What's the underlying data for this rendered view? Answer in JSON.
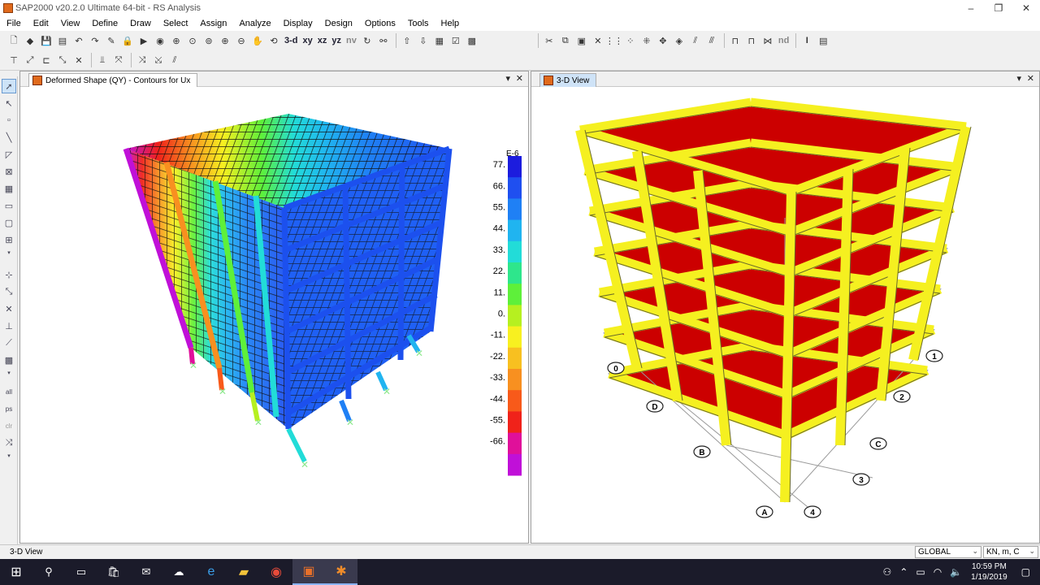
{
  "window": {
    "title": "SAP2000 v20.2.0 Ultimate 64-bit - RS Analysis",
    "controls": [
      "–",
      "❐",
      "✕"
    ]
  },
  "menu": [
    "File",
    "Edit",
    "View",
    "Define",
    "Draw",
    "Select",
    "Assign",
    "Analyze",
    "Display",
    "Design",
    "Options",
    "Tools",
    "Help"
  ],
  "toolbar": {
    "view_3d": "3-d",
    "view_xy": "xy",
    "view_xz": "xz",
    "view_yz": "yz",
    "view_nv": "nv",
    "nd": "nd"
  },
  "left_panel": {
    "tab_title": "Deformed Shape (QY) - Contours for Ux",
    "legend": {
      "exponent": "E-6",
      "labels": [
        "77.",
        "66.",
        "55.",
        "44.",
        "33.",
        "22.",
        "11.",
        "0.",
        "-11.",
        "-22.",
        "-33.",
        "-44.",
        "-55.",
        "-66."
      ],
      "colors": [
        "#1c1cde",
        "#1f4ff0",
        "#1f80f5",
        "#20b4f0",
        "#22dcd8",
        "#2ee68c",
        "#5ef03a",
        "#b6f020",
        "#f8f020",
        "#f8c020",
        "#f89020",
        "#f85a1a",
        "#f0221a",
        "#e0109a",
        "#c010d8"
      ]
    }
  },
  "right_panel": {
    "tab_title": "3-D View",
    "grid_labels": [
      "0",
      "D",
      "B",
      "A",
      "4",
      "3",
      "2",
      "1",
      "C"
    ]
  },
  "statusbar": {
    "text": "3-D View",
    "coord_system": "GLOBAL",
    "units": "KN, m, C"
  },
  "taskbar": {
    "time": "10:59 PM",
    "date": "1/19/2019"
  },
  "colors": {
    "frame_yellow": "#f5f020",
    "slab_red": "#cc0000",
    "tab_active": "#cfe3f7",
    "taskbar": "#1b1b2a"
  }
}
